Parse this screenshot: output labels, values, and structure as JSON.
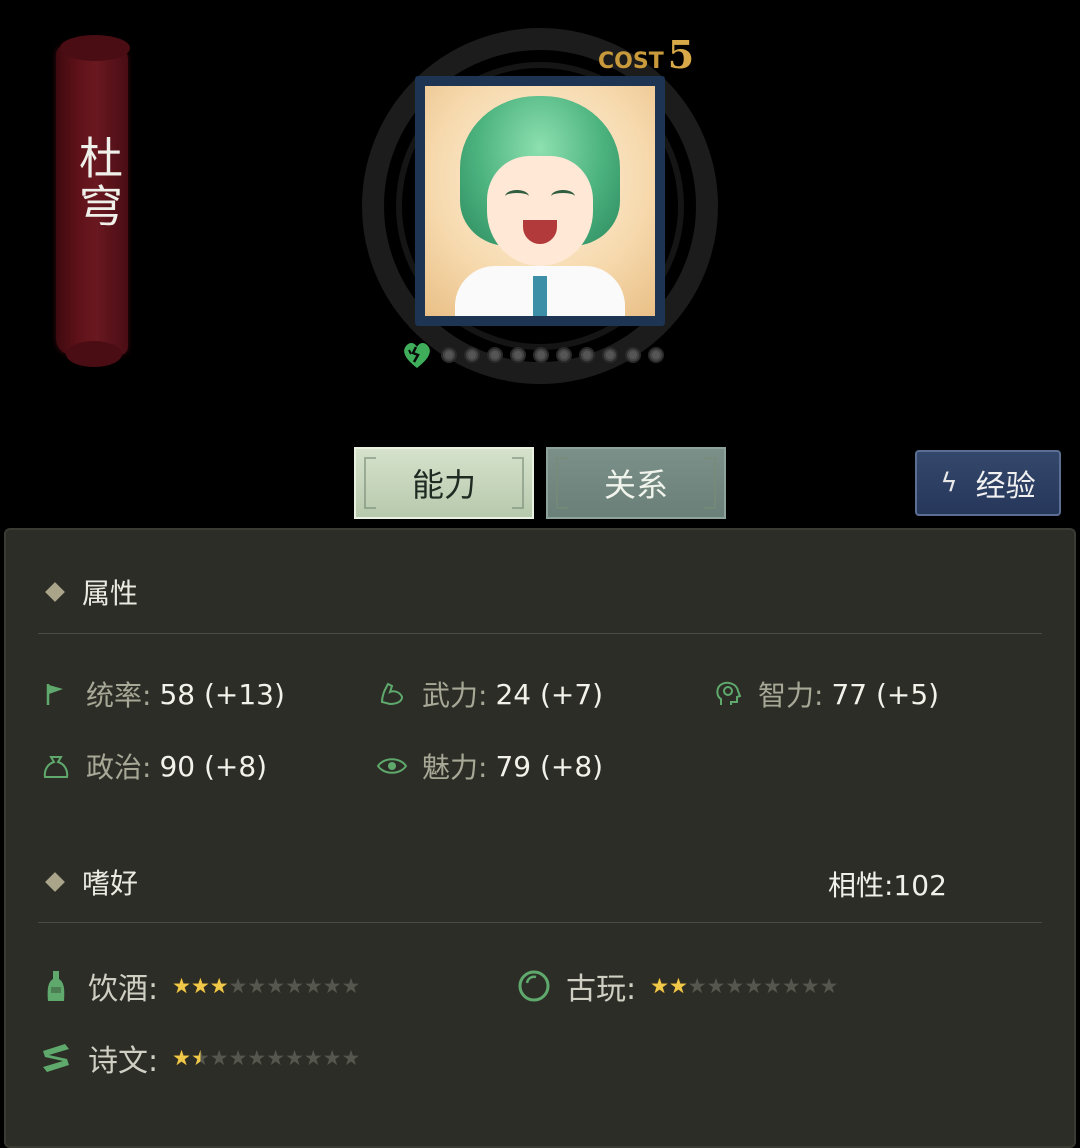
{
  "character": {
    "name": "杜穹",
    "cost_label": "COST",
    "cost_value": "5",
    "bond_filled": 0,
    "bond_total": 10
  },
  "tabs": {
    "ability": "能力",
    "relation": "关系",
    "experience": "经验"
  },
  "attributes": {
    "title": "属性",
    "stats": [
      {
        "icon": "flag-icon",
        "label": "统率:",
        "value": "58 (+13)"
      },
      {
        "icon": "arm-strength-icon",
        "label": "武力:",
        "value": "24 (+7)"
      },
      {
        "icon": "brain-idea-icon",
        "label": "智力:",
        "value": "77 (+5)"
      },
      {
        "icon": "money-bag-icon",
        "label": "政治:",
        "value": "90 (+8)"
      },
      {
        "icon": "eye-icon",
        "label": "魅力:",
        "value": "79 (+8)"
      }
    ]
  },
  "hobbies": {
    "title": "嗜好",
    "affinity": "相性:102",
    "items": [
      {
        "icon": "wine-bottle-icon",
        "label": "饮酒:",
        "stars": 3,
        "max": 10
      },
      {
        "icon": "antique-orb-icon",
        "label": "古玩:",
        "stars": 2,
        "max": 10
      },
      {
        "icon": "scroll-icon",
        "label": "诗文:",
        "stars": 1.5,
        "max": 10
      }
    ]
  },
  "colors": {
    "accent_green": "#5fa96d",
    "banner_red": "#5e1118",
    "panel_bg": "#2c2d26",
    "star_gold": "#f1c94a",
    "cost_gold": "#c99a3c"
  }
}
